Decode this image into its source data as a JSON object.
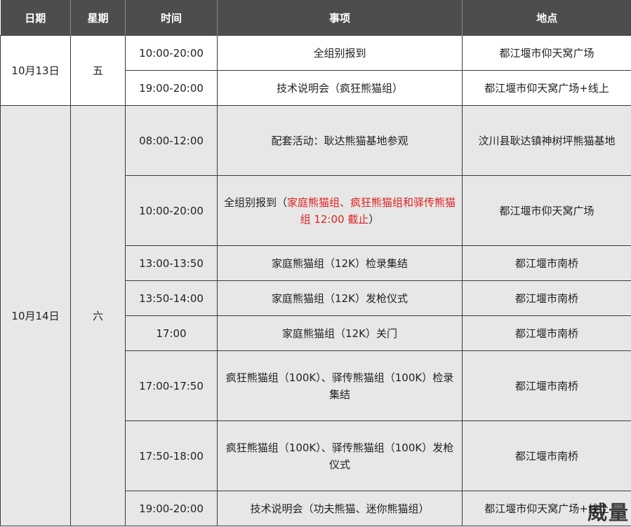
{
  "table": {
    "headers": [
      "日期",
      "星期",
      "时间",
      "事项",
      "地点"
    ],
    "day1": {
      "date": "10月13日",
      "weekday": "五",
      "rows": [
        {
          "time": "10:00-20:00",
          "event": "全组别报到",
          "location": "都江堰市仰天窝广场"
        },
        {
          "time": "19:00-20:00",
          "event": "技术说明会（疯狂熊猫组）",
          "location": "都江堰市仰天窝广场+线上"
        }
      ]
    },
    "day2": {
      "date": "10月14日",
      "weekday": "六",
      "rows": [
        {
          "time": "08:00-12:00",
          "event": "配套活动：耿达熊猫基地参观",
          "location": "汶川县耿达镇神树坪熊猫基地"
        },
        {
          "time": "10:00-20:00",
          "event": "全组别报到（",
          "event_note": "家庭熊猫组、疯狂熊猫组和驿传熊猫组 12:00 截止",
          "event_tail": "）",
          "location": "都江堰市仰天窝广场"
        },
        {
          "time": "13:00-13:50",
          "event": "家庭熊猫组（12K）检录集结",
          "location": "都江堰市南桥"
        },
        {
          "time": "13:50-14:00",
          "event": "家庭熊猫组（12K）发枪仪式",
          "location": "都江堰市南桥"
        },
        {
          "time": "17:00",
          "event": "家庭熊猫组（12K）关门",
          "location": "都江堰市南桥"
        },
        {
          "time": "17:00-17:50",
          "event": "疯狂熊猫组（100K）、驿传熊猫组（100K）检录集结",
          "location": "都江堰市南桥"
        },
        {
          "time": "17:50-18:00",
          "event": "疯狂熊猫组（100K）、驿传熊猫组（100K）发枪仪式",
          "location": "都江堰市南桥"
        },
        {
          "time": "19:00-20:00",
          "event": "技术说明会（功夫熊猫、迷你熊猫组）",
          "location": "都江堰市仰天窝广场+线上"
        }
      ]
    }
  },
  "watermark": "威量"
}
